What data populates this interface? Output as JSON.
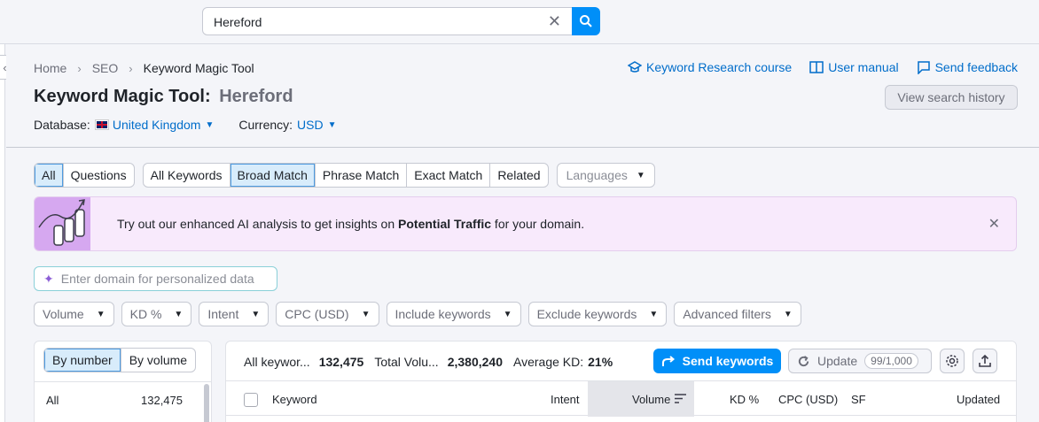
{
  "search": {
    "value": "Hereford"
  },
  "breadcrumb": {
    "items": [
      "Home",
      "SEO",
      "Keyword Magic Tool"
    ]
  },
  "page": {
    "title": "Keyword Magic Tool:",
    "query": "Hereford"
  },
  "database": {
    "label": "Database:",
    "value": "United Kingdom"
  },
  "currency": {
    "label": "Currency:",
    "value": "USD"
  },
  "toplinks": {
    "course": "Keyword Research course",
    "manual": "User manual",
    "feedback": "Send feedback"
  },
  "history_button": "View search history",
  "tabs": {
    "group1": [
      "All",
      "Questions"
    ],
    "group2": [
      "All Keywords",
      "Broad Match",
      "Phrase Match",
      "Exact Match",
      "Related"
    ],
    "languages": "Languages"
  },
  "banner": {
    "text_before": "Try out our enhanced AI analysis to get insights on ",
    "text_bold": "Potential Traffic",
    "text_after": " for your domain."
  },
  "domain_input": {
    "placeholder": "Enter domain for personalized data"
  },
  "filters": [
    "Volume",
    "KD %",
    "Intent",
    "CPC (USD)",
    "Include keywords",
    "Exclude keywords",
    "Advanced filters"
  ],
  "left_panel": {
    "tabs": [
      "By number",
      "By volume"
    ],
    "rows": [
      {
        "name": "All",
        "count": "132,475"
      }
    ]
  },
  "stats": {
    "all_keywords_label": "All keywor...",
    "all_keywords_value": "132,475",
    "total_volume_label": "Total Volu...",
    "total_volume_value": "2,380,240",
    "avg_kd_label": "Average KD:",
    "avg_kd_value": "21%"
  },
  "actions": {
    "send": "Send keywords",
    "update": "Update",
    "update_badge": "99/1,000"
  },
  "table": {
    "columns": [
      "Keyword",
      "Intent",
      "Volume",
      "KD %",
      "CPC (USD)",
      "SF",
      "Updated"
    ]
  },
  "colors": {
    "accent": "#008ff8",
    "link": "#006dca",
    "banner_bg": "#f8eafc"
  }
}
